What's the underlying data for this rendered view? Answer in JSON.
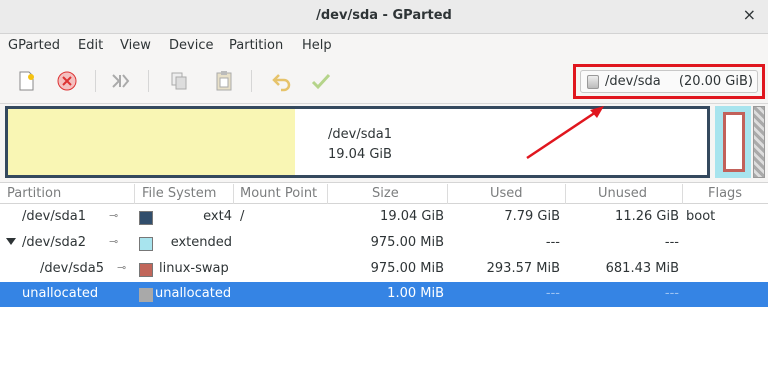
{
  "window": {
    "title": "/dev/sda - GParted",
    "close_glyph": "×"
  },
  "menu": [
    "GParted",
    "Edit",
    "View",
    "Device",
    "Partition",
    "Help"
  ],
  "toolbar": {
    "icons": [
      "new-icon",
      "delete-icon",
      "resize-move-icon",
      "copy-icon",
      "paste-icon",
      "undo-icon",
      "apply-icon"
    ]
  },
  "device": {
    "name": "/dev/sda",
    "size": "(20.00 GiB)"
  },
  "diskmap": {
    "part_name": "/dev/sda1",
    "part_size": "19.04 GiB",
    "used_fraction": 0.41
  },
  "columns": [
    "Partition",
    "File System",
    "Mount Point",
    "Size",
    "Used",
    "Unused",
    "Flags"
  ],
  "rows": [
    {
      "partition": "/dev/sda1",
      "fs": "ext4",
      "fs_color": "#314e6c",
      "mount": "/",
      "size": "19.04 GiB",
      "used": "7.79 GiB",
      "unused": "11.26 GiB",
      "flags": "boot"
    },
    {
      "partition": "/dev/sda2",
      "fs": "extended",
      "fs_color": "#a8e4ee",
      "mount": "",
      "size": "975.00 MiB",
      "used": "---",
      "unused": "---",
      "flags": ""
    },
    {
      "partition": "/dev/sda5",
      "fs": "linux-swap",
      "fs_color": "#c1665a",
      "mount": "",
      "size": "975.00 MiB",
      "used": "293.57 MiB",
      "unused": "681.43 MiB",
      "flags": ""
    },
    {
      "partition": "unallocated",
      "fs": "unallocated",
      "fs_color": "#a9a9a9",
      "mount": "",
      "size": "1.00 MiB",
      "used": "---",
      "unused": "---",
      "flags": ""
    }
  ],
  "colors": {
    "selection": "#3584e4",
    "highlight": "#e0161e"
  }
}
